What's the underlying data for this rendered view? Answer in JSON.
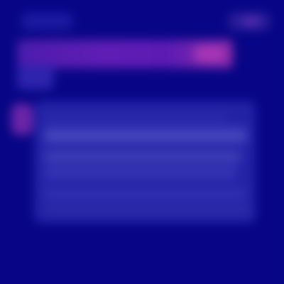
{
  "app": {
    "title": "",
    "theme": "blurred-indigo-ui"
  },
  "colors": {
    "background": "#080686",
    "panel": "#2222a5",
    "accent_purple": "#6c24a8",
    "accent_pink": "#b13bb5",
    "row_light": "#4343bc",
    "row_mid": "#3835b4"
  },
  "icons": {
    "top_left": "menu-icon",
    "top_right": "profile-icon",
    "side_indicator": "status-icon"
  },
  "header": {
    "top_left_label": "",
    "top_right_label": "",
    "banner_text": "",
    "banner_subtext": ""
  },
  "content": {
    "row_1": "",
    "row_2": "",
    "row_3": "",
    "row_4": "",
    "row_5": "",
    "row_6": ""
  }
}
